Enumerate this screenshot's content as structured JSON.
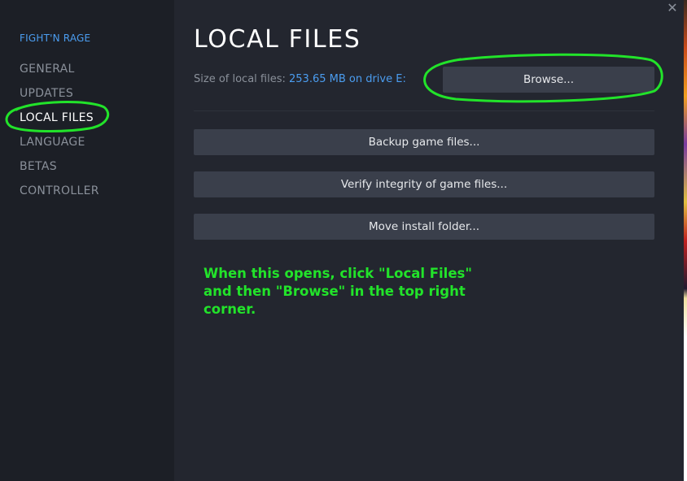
{
  "sidebar": {
    "game_title": "FIGHT'N RAGE",
    "items": [
      {
        "label": "GENERAL"
      },
      {
        "label": "UPDATES"
      },
      {
        "label": "LOCAL FILES",
        "active": true
      },
      {
        "label": "LANGUAGE"
      },
      {
        "label": "BETAS"
      },
      {
        "label": "CONTROLLER"
      }
    ]
  },
  "main": {
    "title": "LOCAL FILES",
    "size_label": "Size of local files:",
    "size_value": "253.65 MB on drive E:",
    "browse_label": "Browse...",
    "buttons": [
      {
        "label": "Backup game files..."
      },
      {
        "label": "Verify integrity of game files..."
      },
      {
        "label": "Move install folder..."
      }
    ]
  },
  "annotation": {
    "text": "When this opens, click \"Local Files\" and then \"Browse\" in the top right corner.",
    "color": "#22e32a"
  },
  "window": {
    "close_icon": "close-icon"
  },
  "colors": {
    "sidebar_bg": "#1c1f26",
    "main_bg": "#23262f",
    "accent": "#4b9df0",
    "button_bg": "#3a3f4b"
  }
}
